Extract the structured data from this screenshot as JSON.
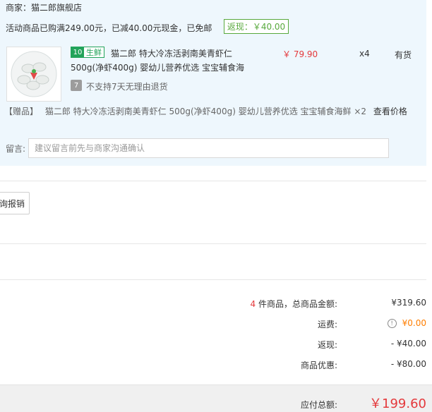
{
  "merchant": {
    "label": "商家：",
    "name": "猫二郎旗舰店"
  },
  "promo": {
    "text": "活动商品已购满249.00元，已减40.00元现金，已免邮",
    "returns_badge": "返现：￥40.00"
  },
  "product": {
    "tag_icon": "10",
    "tag_label": "生鲜",
    "title_line1": "猫二郎 特大冷冻活剥南美青虾仁",
    "title_line2": "500g(净虾400g) 婴幼儿营养优选 宝宝辅食海",
    "price": "￥ 79.90",
    "quantity": "x4",
    "stock": "有货",
    "return_icon": "7",
    "return_policy": "不支持7天无理由退货"
  },
  "gift": {
    "label": "【赠品】",
    "text": "猫二郎 特大冷冻活剥南美青虾仁 500g(净虾400g) 婴幼儿营养优选 宝宝辅食海鲜 ×2",
    "link": "查看价格"
  },
  "note": {
    "label": "留言:",
    "placeholder": "建议留言前先与商家沟通确认"
  },
  "report_button": "询报销",
  "summary": {
    "count": "4",
    "count_suffix": "件商品，总商品金额:",
    "total": "¥319.60",
    "shipping_label": "运费:",
    "shipping": "¥0.00",
    "cashback_label": "返现:",
    "cashback": "- ¥40.00",
    "discount_label": "商品优惠:",
    "discount": "- ¥80.00"
  },
  "footer": {
    "payable_label": "应付总额:",
    "payable": "￥199.60"
  },
  "colors": {
    "accent_red": "#e4393c",
    "green": "#58a93d",
    "light_blue_bg": "#eef7fd"
  }
}
